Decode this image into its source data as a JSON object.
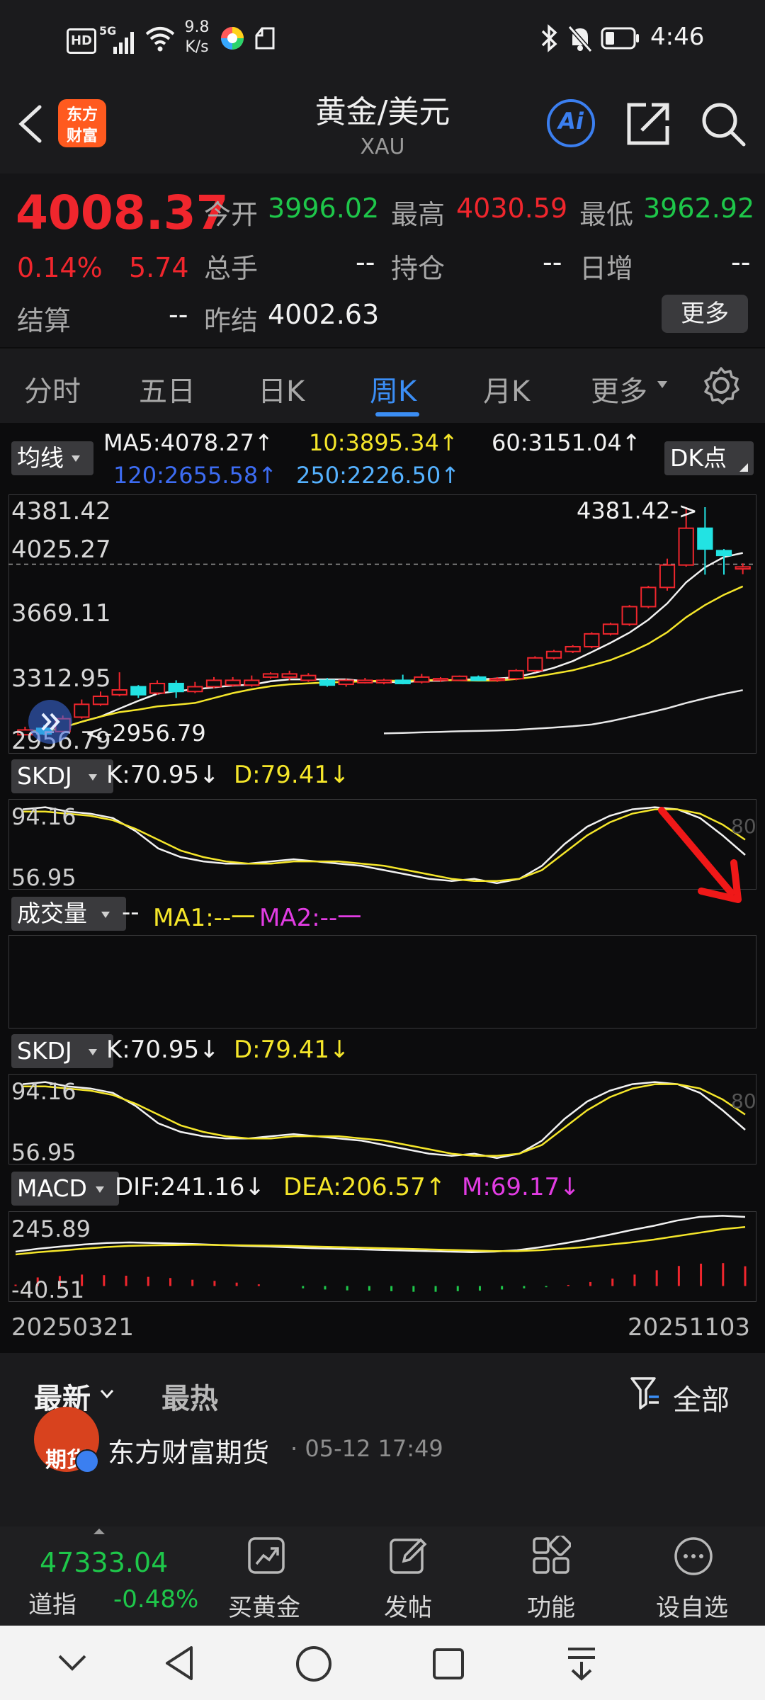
{
  "status_bar": {
    "hd": "HD",
    "net": "5G",
    "speed_top": "9.8",
    "speed_bottom": "K/s",
    "time": "4:46"
  },
  "header": {
    "logo_line1": "东方",
    "logo_line2": "财富",
    "title": "黄金/美元",
    "subtitle": "XAU",
    "ai_label": "Ai"
  },
  "quote": {
    "price": "4008.37",
    "change_pct": "0.14%",
    "change": "5.74",
    "open_label": "今开",
    "open": "3996.02",
    "high_label": "最高",
    "high": "4030.59",
    "low_label": "最低",
    "low": "3962.92",
    "volume_label": "总手",
    "volume": "--",
    "position_label": "持仓",
    "position": "--",
    "daily_inc_label": "日增",
    "daily_inc": "--",
    "settle_label": "结算",
    "settle": "--",
    "prev_settle_label": "昨结",
    "prev_settle": "4002.63",
    "more_button": "更多"
  },
  "tabs": [
    "分时",
    "五日",
    "日K",
    "周K",
    "月K",
    "更多"
  ],
  "active_tab": 3,
  "ma_row": {
    "selector": "均线",
    "ma5": "MA5:4078.27↑",
    "ma10": "10:3895.34↑",
    "ma60": "60:3151.04↑",
    "ma120": "120:2655.58↑",
    "ma250": "250:2226.50↑",
    "dk_button": "DK点"
  },
  "main_chart": {
    "y_top": "4381.42",
    "y_ref": "4025.27",
    "y_mid": "3669.11",
    "y_low": "3312.95",
    "y_bottom": "2956.79",
    "max_marker": "4381.42->",
    "min_marker": "<-2956.79"
  },
  "skdj1": {
    "selector": "SKDJ",
    "k": "K:70.95↓",
    "d": "D:79.41↓",
    "y_top": "94.16",
    "y_bottom": "56.95",
    "ref": "80"
  },
  "volume": {
    "selector": "成交量",
    "dash": "--",
    "ma1": "MA1:--一",
    "ma2": "MA2:--一"
  },
  "skdj2": {
    "selector": "SKDJ",
    "k": "K:70.95↓",
    "d": "D:79.41↓",
    "y_top": "94.16",
    "y_bottom": "56.95",
    "ref": "80"
  },
  "macd": {
    "selector": "MACD",
    "dif": "DIF:241.16↓",
    "dea": "DEA:206.57↑",
    "m": "M:69.17↓",
    "y_top": "245.89",
    "y_bottom": "-40.51"
  },
  "dates": {
    "start": "20250321",
    "end": "20251103"
  },
  "feed": {
    "tab_latest": "最新",
    "tab_hot": "最热",
    "filter": "全部",
    "post_avatar_text": "期货",
    "post_author": "东方财富期货",
    "post_time": "· 05-12 17:49"
  },
  "bottom_bar": {
    "index_value": "47333.04",
    "index_name": "道指",
    "index_change": "-0.48%",
    "buy_gold": "买黄金",
    "post": "发帖",
    "functions": "功能",
    "add_watch": "设自选"
  },
  "chart_data": [
    {
      "type": "candlestick",
      "title": "",
      "x_start": "20250321",
      "x_end": "20251103",
      "ylim": [
        2956.79,
        4381.42
      ],
      "reference_line": 4025.27,
      "candles": [
        {
          "o": 2960,
          "c": 2990,
          "h": 3010,
          "l": 2956.79,
          "up": true
        },
        {
          "o": 3000,
          "c": 2965,
          "h": 3020,
          "l": 2958,
          "up": false
        },
        {
          "o": 2980,
          "c": 3060,
          "h": 3080,
          "l": 2975,
          "up": true
        },
        {
          "o": 3070,
          "c": 3150,
          "h": 3180,
          "l": 3060,
          "up": true
        },
        {
          "o": 3150,
          "c": 3200,
          "h": 3230,
          "l": 3140,
          "up": true
        },
        {
          "o": 3210,
          "c": 3240,
          "h": 3350,
          "l": 3200,
          "up": true
        },
        {
          "o": 3260,
          "c": 3210,
          "h": 3270,
          "l": 3190,
          "up": false
        },
        {
          "o": 3220,
          "c": 3280,
          "h": 3300,
          "l": 3210,
          "up": true
        },
        {
          "o": 3280,
          "c": 3230,
          "h": 3300,
          "l": 3190,
          "up": false
        },
        {
          "o": 3230,
          "c": 3260,
          "h": 3290,
          "l": 3220,
          "up": true
        },
        {
          "o": 3260,
          "c": 3300,
          "h": 3320,
          "l": 3250,
          "up": true
        },
        {
          "o": 3300,
          "c": 3270,
          "h": 3320,
          "l": 3260,
          "up": true
        },
        {
          "o": 3270,
          "c": 3300,
          "h": 3330,
          "l": 3260,
          "up": true
        },
        {
          "o": 3320,
          "c": 3340,
          "h": 3350,
          "l": 3310,
          "up": true
        },
        {
          "o": 3340,
          "c": 3320,
          "h": 3360,
          "l": 3300,
          "up": true
        },
        {
          "o": 3330,
          "c": 3300,
          "h": 3345,
          "l": 3290,
          "up": true
        },
        {
          "o": 3300,
          "c": 3270,
          "h": 3315,
          "l": 3260,
          "up": false
        },
        {
          "o": 3275,
          "c": 3300,
          "h": 3310,
          "l": 3260,
          "up": true
        },
        {
          "o": 3300,
          "c": 3285,
          "h": 3315,
          "l": 3280,
          "up": true
        },
        {
          "o": 3285,
          "c": 3300,
          "h": 3310,
          "l": 3275,
          "up": true
        },
        {
          "o": 3300,
          "c": 3280,
          "h": 3335,
          "l": 3275,
          "up": false
        },
        {
          "o": 3290,
          "c": 3320,
          "h": 3340,
          "l": 3280,
          "up": true
        },
        {
          "o": 3310,
          "c": 3300,
          "h": 3320,
          "l": 3290,
          "up": true
        },
        {
          "o": 3300,
          "c": 3325,
          "h": 3330,
          "l": 3295,
          "up": true
        },
        {
          "o": 3320,
          "c": 3300,
          "h": 3330,
          "l": 3295,
          "up": false
        },
        {
          "o": 3300,
          "c": 3310,
          "h": 3320,
          "l": 3290,
          "up": true
        },
        {
          "o": 3310,
          "c": 3360,
          "h": 3370,
          "l": 3300,
          "up": true
        },
        {
          "o": 3360,
          "c": 3440,
          "h": 3450,
          "l": 3350,
          "up": true
        },
        {
          "o": 3440,
          "c": 3480,
          "h": 3490,
          "l": 3430,
          "up": true
        },
        {
          "o": 3480,
          "c": 3510,
          "h": 3520,
          "l": 3470,
          "up": true
        },
        {
          "o": 3510,
          "c": 3590,
          "h": 3600,
          "l": 3500,
          "up": true
        },
        {
          "o": 3590,
          "c": 3650,
          "h": 3660,
          "l": 3580,
          "up": true
        },
        {
          "o": 3650,
          "c": 3760,
          "h": 3770,
          "l": 3640,
          "up": true
        },
        {
          "o": 3760,
          "c": 3880,
          "h": 3890,
          "l": 3750,
          "up": true
        },
        {
          "o": 3880,
          "c": 4020,
          "h": 4060,
          "l": 3860,
          "up": true
        },
        {
          "o": 4020,
          "c": 4250,
          "h": 4381.42,
          "l": 4010,
          "up": true
        },
        {
          "o": 4250,
          "c": 4120,
          "h": 4381.42,
          "l": 3960,
          "up": false
        },
        {
          "o": 4110,
          "c": 4080,
          "h": 4120,
          "l": 3960,
          "up": false
        },
        {
          "o": 3996.02,
          "c": 4008.37,
          "h": 4030.59,
          "l": 3962.92,
          "up": true
        }
      ]
    },
    {
      "type": "line",
      "title": "",
      "ylim": [
        56.95,
        94.16
      ],
      "series": [
        {
          "name": "K",
          "values": [
            92,
            93,
            91,
            90,
            88,
            82,
            74,
            70,
            68,
            67,
            67,
            68,
            69,
            68,
            67,
            66,
            64,
            62,
            60,
            59,
            60,
            58,
            60,
            66,
            76,
            84,
            89,
            92,
            93,
            92,
            88,
            80,
            71
          ]
        },
        {
          "name": "D",
          "values": [
            91,
            91,
            90,
            89,
            87,
            83,
            78,
            73,
            70,
            68,
            67,
            67,
            68,
            68,
            68,
            67,
            66,
            64,
            62,
            60,
            59,
            59,
            60,
            64,
            72,
            80,
            86,
            90,
            92,
            92,
            90,
            85,
            78
          ]
        }
      ]
    },
    {
      "type": "bar",
      "title": "",
      "ylim": [
        -40.51,
        245.89
      ],
      "series": [
        {
          "name": "M",
          "values": [
            5,
            30,
            35,
            40,
            38,
            36,
            32,
            28,
            22,
            18,
            12,
            6,
            0,
            -8,
            -12,
            -15,
            -16,
            -18,
            -20,
            -20,
            -18,
            -16,
            -12,
            -8,
            -4,
            4,
            14,
            26,
            40,
            55,
            70,
            78,
            80,
            69
          ]
        },
        {
          "name": "DIF",
          "values": [
            120,
            130,
            138,
            145,
            150,
            152,
            150,
            148,
            146,
            143,
            140,
            138,
            135,
            132,
            130,
            128,
            126,
            124,
            122,
            120,
            118,
            120,
            125,
            135,
            148,
            162,
            178,
            195,
            210,
            228,
            241,
            245,
            241
          ]
        },
        {
          "name": "DEA",
          "values": [
            110,
            118,
            124,
            130,
            136,
            140,
            142,
            143,
            144,
            143,
            142,
            141,
            140,
            138,
            136,
            134,
            132,
            130,
            128,
            126,
            124,
            122,
            122,
            125,
            130,
            136,
            144,
            152,
            162,
            174,
            186,
            198,
            206
          ]
        }
      ]
    }
  ]
}
